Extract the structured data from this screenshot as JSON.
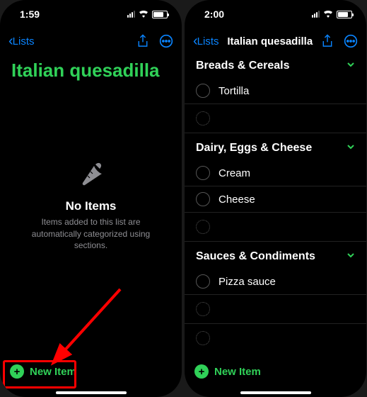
{
  "left": {
    "statusbar": {
      "time": "1:59"
    },
    "navbar": {
      "back_label": "Lists"
    },
    "title": "Italian quesadilla",
    "empty": {
      "title": "No Items",
      "subtitle": "Items added to this list are automatically categorized using sections."
    },
    "new_item": "New Item"
  },
  "right": {
    "statusbar": {
      "time": "2:00"
    },
    "navbar": {
      "back_label": "Lists",
      "title": "Italian quesadilla"
    },
    "sections": [
      {
        "title": "Breads & Cereals",
        "items": [
          "Tortilla"
        ]
      },
      {
        "title": "Dairy, Eggs & Cheese",
        "items": [
          "Cream",
          "Cheese"
        ]
      },
      {
        "title": "Sauces & Condiments",
        "items": [
          "Pizza sauce"
        ]
      }
    ],
    "new_item": "New Item"
  },
  "colors": {
    "accent_green": "#30D158",
    "accent_blue": "#0A84FF",
    "highlight_red": "#ff0000"
  }
}
